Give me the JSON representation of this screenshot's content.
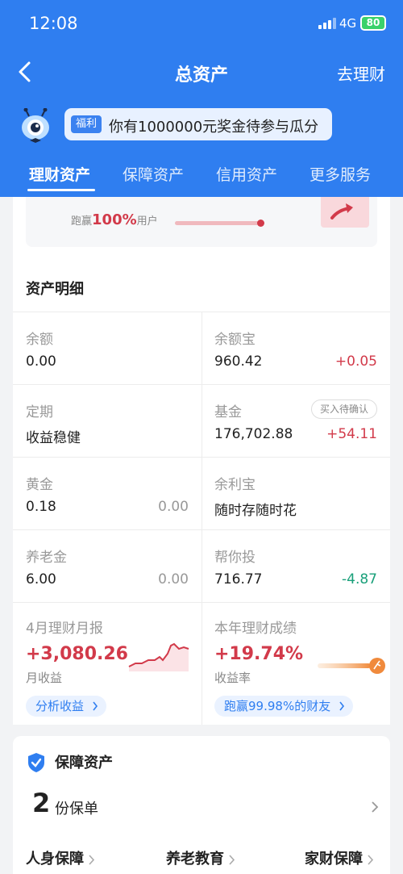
{
  "status_bar": {
    "time": "12:08",
    "network": "4G",
    "battery": "80"
  },
  "nav": {
    "title": "总资产",
    "right_action": "去理财"
  },
  "promo": {
    "tag": "福利",
    "text": "你有1000000元奖金待参与瓜分"
  },
  "tabs": [
    {
      "label": "理财资产",
      "active": true
    },
    {
      "label": "保障资产",
      "active": false
    },
    {
      "label": "信用资产",
      "active": false
    },
    {
      "label": "更多服务",
      "active": false
    }
  ],
  "top_card": {
    "run_prefix": "跑赢",
    "run_percent": "100%",
    "run_suffix": "用户",
    "run_progress": 1.0
  },
  "details": {
    "title": "资产明细",
    "items": [
      {
        "label": "余额",
        "value": "0.00",
        "change": ""
      },
      {
        "label": "余额宝",
        "value": "960.42",
        "change": "+0.05"
      },
      {
        "label": "定期",
        "value": "收益稳健",
        "change": ""
      },
      {
        "label": "基金",
        "value": "176,702.88",
        "change": "+54.11",
        "badge": "买入待确认"
      },
      {
        "label": "黄金",
        "value": "0.18",
        "change": "0.00"
      },
      {
        "label": "余利宝",
        "value": "随时存随时花",
        "change": ""
      },
      {
        "label": "养老金",
        "value": "6.00",
        "change": "0.00"
      },
      {
        "label": "帮你投",
        "value": "716.77",
        "change": "-4.87"
      }
    ],
    "monthly": {
      "label": "4月理财月报",
      "value": "+3,080.26",
      "sub": "月收益",
      "button": "分析收益"
    },
    "yearly": {
      "label": "本年理财成绩",
      "value": "+19.74%",
      "sub": "收益率",
      "button": "跑赢99.98%的财友"
    }
  },
  "protection": {
    "title": "保障资产",
    "count": "2",
    "unit": "份保单",
    "categories": [
      "人身保障",
      "养老教育",
      "家财保障"
    ]
  },
  "colors": {
    "brand_blue": "#2f7ef0",
    "gain_red": "#d23a4a",
    "loss_green": "#1aa07a"
  }
}
